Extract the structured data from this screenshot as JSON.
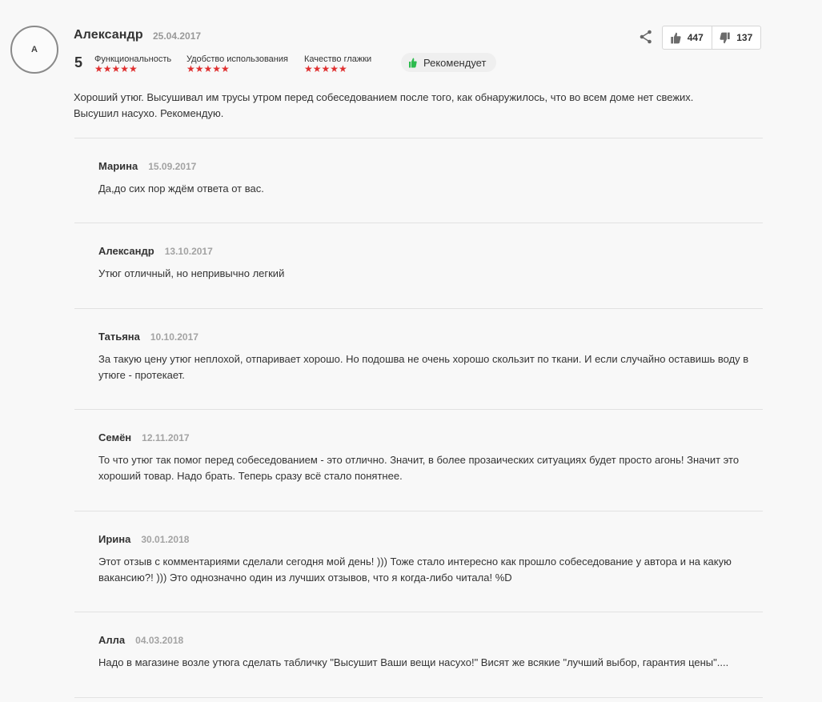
{
  "review": {
    "avatar_letter": "А",
    "author": "Александр",
    "date": "25.04.2017",
    "overall_rating": "5",
    "criteria": [
      {
        "label": "Функциональность",
        "stars": "★★★★★",
        "rating": 5
      },
      {
        "label": "Удобство использования",
        "stars": "★★★★★",
        "rating": 5
      },
      {
        "label": "Качество глажки",
        "stars": "★★★★★",
        "rating": 5
      }
    ],
    "recommend_label": "Рекомендует",
    "likes": "447",
    "dislikes": "137",
    "text": "Хороший утюг. Высушивал им трусы утром перед собеседованием после того, как обнаружилось, что во всем доме нет свежих. Высушил насухо. Рекомендую."
  },
  "comments": [
    {
      "name": "Марина",
      "date": "15.09.2017",
      "text": "Да,до сих пор ждём ответа от вас."
    },
    {
      "name": "Александр",
      "date": "13.10.2017",
      "text": "Утюг отличный, но непривычно легкий"
    },
    {
      "name": "Татьяна",
      "date": "10.10.2017",
      "text": "За такую цену утюг неплохой, отпаривает хорошо. Но подошва не очень хорошо скользит по ткани. И если случайно оставишь воду в утюге - протекает."
    },
    {
      "name": "Семён",
      "date": "12.11.2017",
      "text": "То что утюг так помог перед собеседованием - это отлично. Значит, в более прозаических ситуациях будет просто агонь! Значит это хороший товар. Надо брать. Теперь сразу всё стало понятнее."
    },
    {
      "name": "Ирина",
      "date": "30.01.2018",
      "text": "Этот отзыв с комментариями сделали сегодня мой день! ))) Тоже стало интересно как прошло собеседование у автора и на какую вакансию?! ))) Это однозначно один из лучших отзывов, что я когда-либо читала! %D"
    },
    {
      "name": "Алла",
      "date": "04.03.2018",
      "text": "Надо в магазине возле утюга сделать табличку \"Высушит Ваши вещи насухо!\" Висят же всякие \"лучший выбор, гарантия цены\"...."
    }
  ],
  "colors": {
    "star": "#e03030",
    "recommend_thumb": "#2dbb4e",
    "muted": "#999999"
  },
  "icons": {
    "share": "share-icon",
    "like": "thumbs-up-icon",
    "dislike": "thumbs-down-icon",
    "recommend": "thumbs-up-icon"
  }
}
